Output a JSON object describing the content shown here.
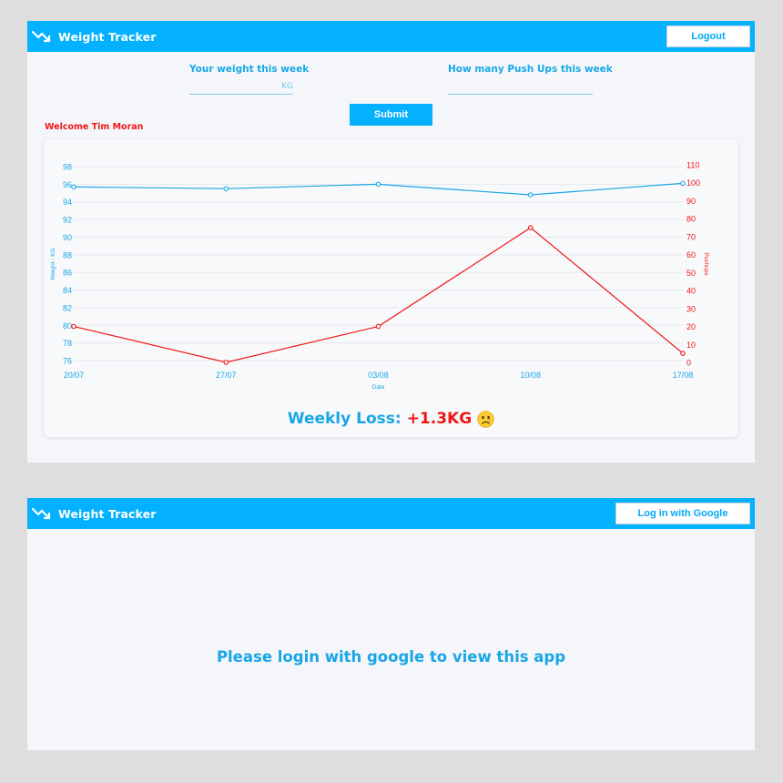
{
  "app": {
    "title": "Weight Tracker",
    "accent_color": "#03b1fe",
    "weight_color": "#1aa6e6",
    "pushups_color": "#f01616"
  },
  "dashboard": {
    "logout_label": "Logout",
    "weight_label": "Your weight this week",
    "weight_placeholder": "KG",
    "pushups_label": "How many Push Ups this week",
    "pushups_placeholder": "",
    "submit_label": "Submit",
    "welcome": "Welcome Tim Moran",
    "summary_label": "Weekly Loss:",
    "summary_value": "+1.3KG",
    "summary_icon": "sad-face-emoji"
  },
  "login_screen": {
    "google_button_label": "Log in with Google",
    "message": "Please login with google to view this app"
  },
  "chart_data": {
    "type": "line",
    "categories": [
      "20/07",
      "27/07",
      "03/08",
      "10/08",
      "17/08"
    ],
    "series": [
      {
        "values": [
          95.7,
          95.5,
          96.0,
          94.8,
          96.1
        ],
        "axis": "left",
        "color": "#1aa6e6"
      },
      {
        "values": [
          20,
          0,
          20,
          75,
          5
        ],
        "axis": "right",
        "color": "#f01616"
      }
    ],
    "xlabel": "Date",
    "ylabel": "Weight - KG",
    "y2label": "Pushups",
    "ylim": [
      76,
      98
    ],
    "y2lim": [
      0,
      110
    ],
    "yticks": [
      98,
      96,
      94,
      92,
      90,
      88,
      86,
      84,
      82,
      80,
      78,
      76
    ],
    "y2ticks": [
      110,
      100,
      90,
      80,
      70,
      60,
      50,
      40,
      30,
      20,
      10,
      0
    ],
    "grid": true
  }
}
